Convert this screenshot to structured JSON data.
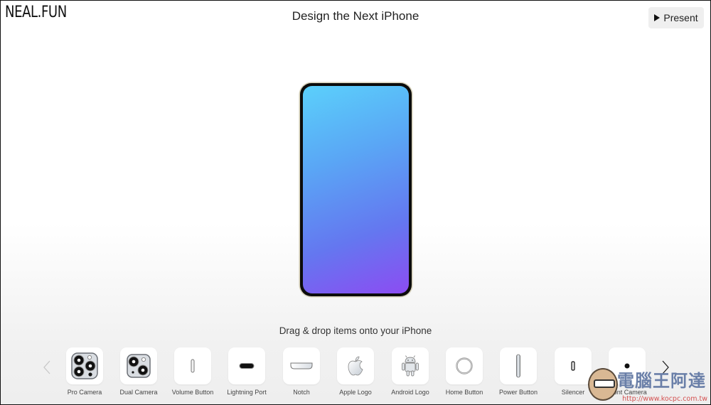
{
  "header": {
    "logo": "NEAL.FUN",
    "title": "Design the Next iPhone",
    "present_label": "Present",
    "present_icon": "play-icon"
  },
  "canvas": {
    "device": "iphone-blank",
    "screen_gradient": [
      "#5bd0fb",
      "#5aa6f5",
      "#6477f0",
      "#8c4cf2"
    ],
    "frame_color": "#0c0c0c"
  },
  "instruction": "Drag & drop items onto your iPhone",
  "tray": {
    "prev_icon": "chevron-left-icon",
    "next_icon": "chevron-right-icon",
    "items": [
      {
        "label": "Pro Camera",
        "icon": "pro-camera-icon"
      },
      {
        "label": "Dual Camera",
        "icon": "dual-camera-icon"
      },
      {
        "label": "Volume Button",
        "icon": "volume-button-icon"
      },
      {
        "label": "Lightning Port",
        "icon": "lightning-port-icon"
      },
      {
        "label": "Notch",
        "icon": "notch-icon"
      },
      {
        "label": "Apple Logo",
        "icon": "apple-logo-icon"
      },
      {
        "label": "Android Logo",
        "icon": "android-logo-icon"
      },
      {
        "label": "Home Button",
        "icon": "home-button-icon"
      },
      {
        "label": "Power Button",
        "icon": "power-button-icon"
      },
      {
        "label": "Silencer",
        "icon": "silencer-icon"
      },
      {
        "label": "Front Camera",
        "icon": "front-camera-icon"
      }
    ]
  },
  "watermark": {
    "text": "電腦王阿達",
    "url": "http://www.kocpc.com.tw"
  }
}
